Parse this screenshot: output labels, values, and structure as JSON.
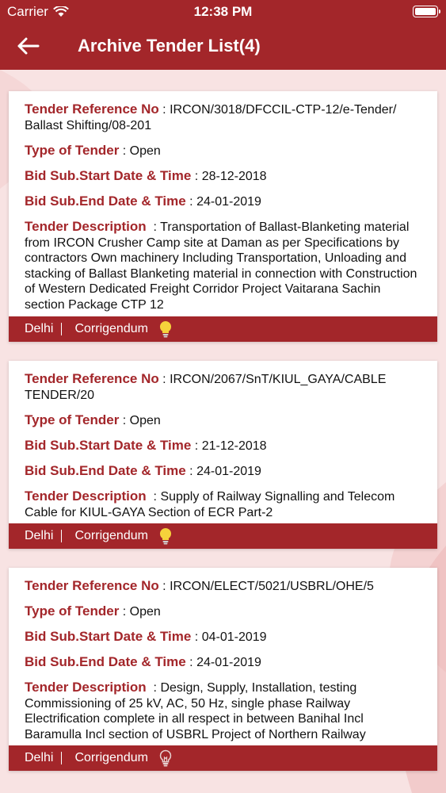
{
  "status": {
    "carrier": "Carrier",
    "time": "12:38 PM"
  },
  "header": {
    "title": "Archive Tender List(4)",
    "back_icon": "arrow-left-icon"
  },
  "labels": {
    "ref": "Tender Reference No",
    "type": "Type of Tender",
    "start": "Bid Sub.Start Date & Time",
    "end": "Bid Sub.End Date & Time",
    "desc": "Tender Description"
  },
  "colors": {
    "brand": "#a3262a",
    "bulb_on": "#f5d23b"
  },
  "tenders": [
    {
      "ref": "IRCON/3018/DFCCIL-CTP-12/e-Tender/ Ballast Shifting/08-201",
      "type": "Open",
      "start": "28-12-2018",
      "end": "24-01-2019",
      "desc": "Transportation of Ballast-Blanketing material from IRCON Crusher Camp site at Daman as per Specifications by contractors Own machinery Including Transportation, Unloading and stacking of Ballast Blanketing material in connection with Construction of Western Dedicated Freight Corridor Project Vaitarana Sachin section Package CTP 12",
      "city": "Delhi",
      "corrigendum": "Corrigendum",
      "bulb_icon": "lightbulb-lit-icon"
    },
    {
      "ref": "IRCON/2067/SnT/KIUL_GAYA/CABLE TENDER/20",
      "type": "Open",
      "start": "21-12-2018",
      "end": "24-01-2019",
      "desc": "Supply of Railway Signalling and Telecom Cable for KIUL-GAYA Section of ECR Part-2",
      "city": "Delhi",
      "corrigendum": "Corrigendum",
      "bulb_icon": "lightbulb-lit-icon"
    },
    {
      "ref": "IRCON/ELECT/5021/USBRL/OHE/5",
      "type": "Open",
      "start": "04-01-2019",
      "end": "24-01-2019",
      "desc": "Design, Supply, Installation, testing Commissioning of 25 kV, AC, 50 Hz, single phase Railway Electrification complete in all respect in between Banihal Incl Baramulla Incl section of USBRL Project of Northern Railway",
      "city": "Delhi",
      "corrigendum": "Corrigendum",
      "bulb_icon": "lightbulb-outline-icon"
    }
  ]
}
